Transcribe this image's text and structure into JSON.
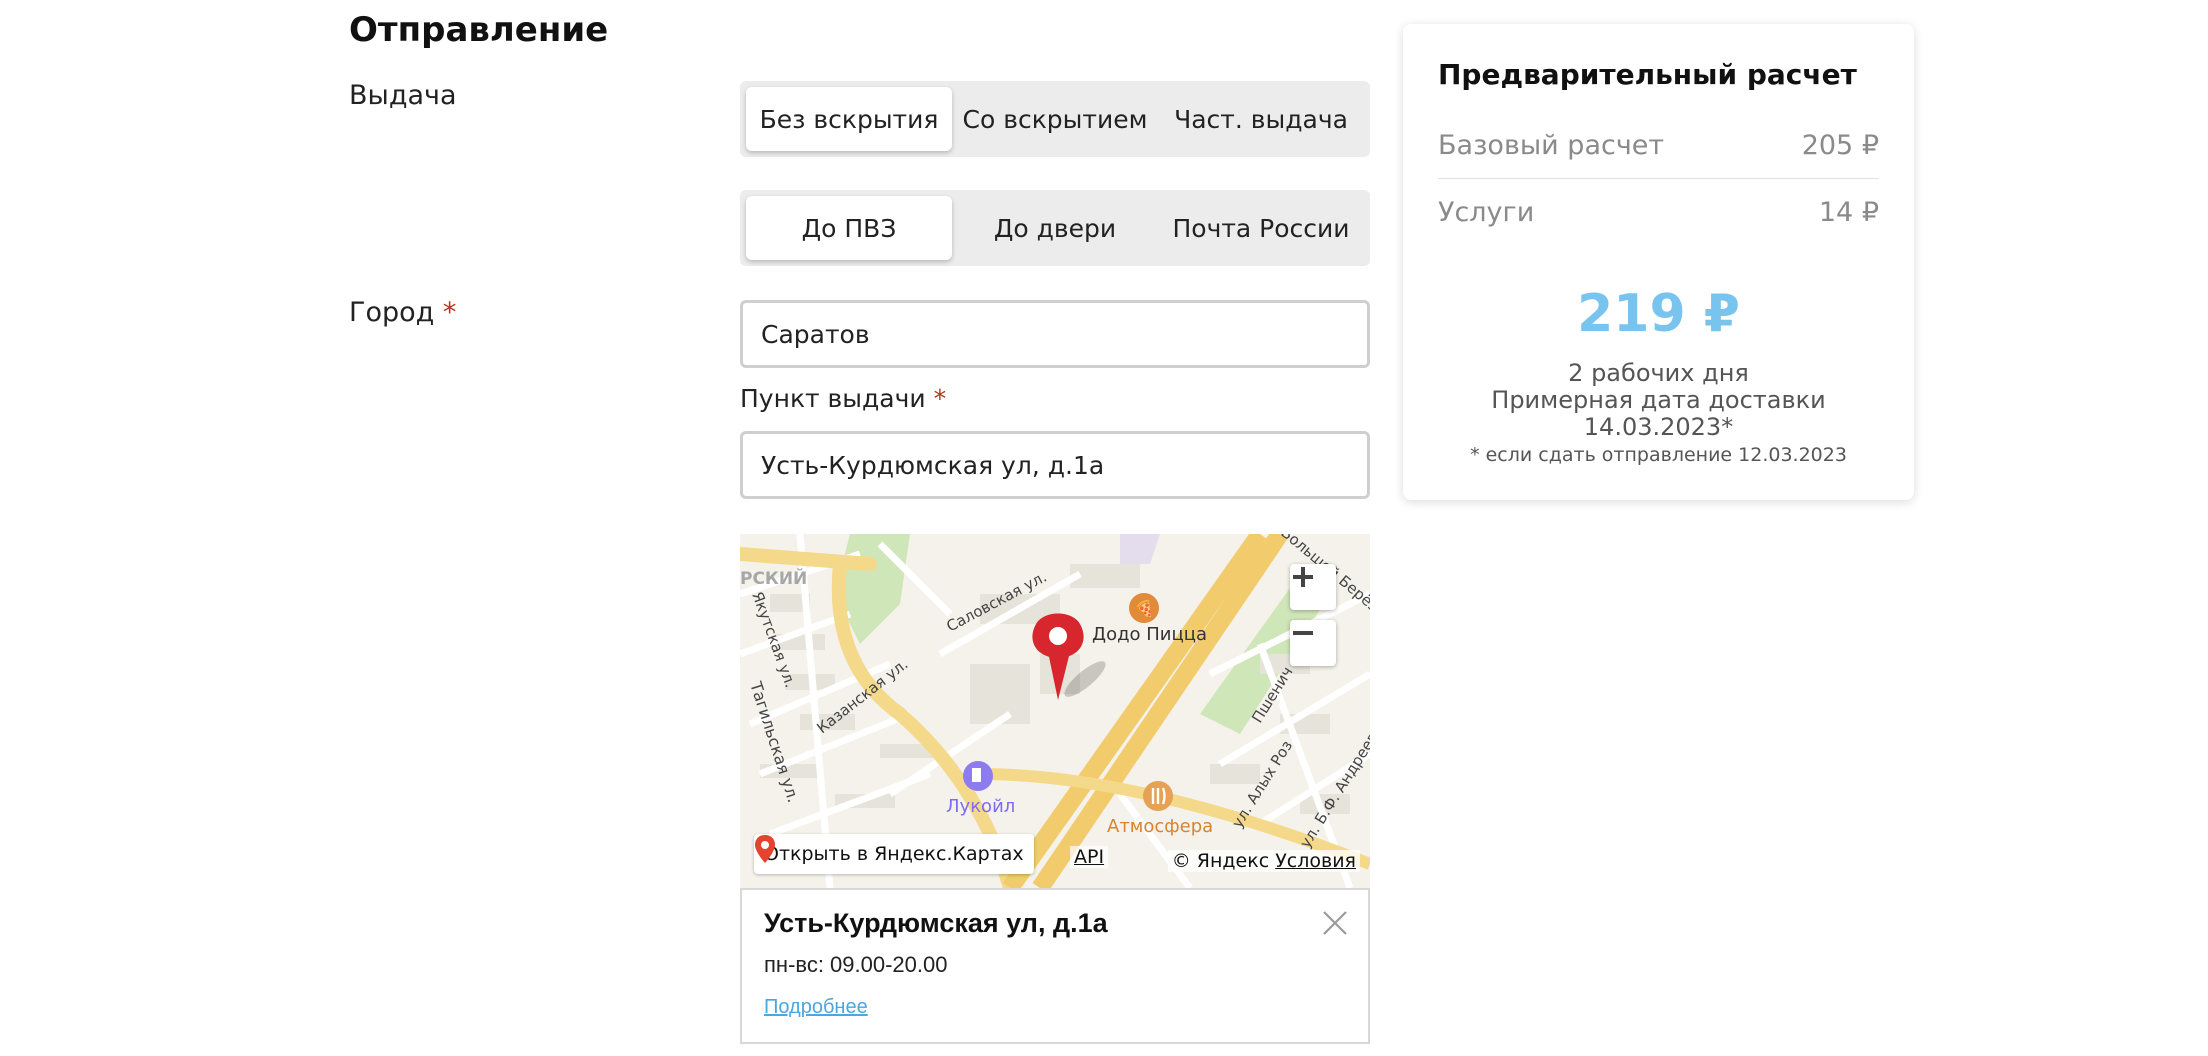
{
  "section": {
    "title": "Отправление"
  },
  "issue": {
    "label": "Выдача",
    "options": [
      "Без вскрытия",
      "Со вскрытием",
      "Част. выдача"
    ],
    "selected": "Без вскрытия"
  },
  "delivery": {
    "options": [
      "До ПВЗ",
      "До двери",
      "Почта России"
    ],
    "selected": "До ПВЗ"
  },
  "city": {
    "label": "Город",
    "required_mark": "*",
    "value": "Саратов"
  },
  "pickup_point": {
    "label": "Пункт выдачи",
    "required_mark": "*",
    "value": "Усть-Курдюмская ул, д.1а"
  },
  "map": {
    "labels": {
      "district": "РСКИЙ",
      "street_yakutskaya": "Якутская ул.",
      "street_salovskaya": "Саловская ул.",
      "street_kazanskaya": "Казанская ул.",
      "street_tagilskaya": "Тагильская ул.",
      "street_bolshoy": "Большой Берёзн",
      "street_pshenich": "Пшенич",
      "street_alykh_roz": "ул. Алых Роз",
      "street_andreeva": "ул. Б.Ф. Андреева"
    },
    "pois": {
      "dodo": "Додо Пицца",
      "lukoil": "Лукойл",
      "atmosfera": "Атмосфера"
    },
    "open_in_yandex": "Открыть в Яндекс.Картах",
    "api": "API",
    "copyright": "© Яндекс",
    "terms": "Условия"
  },
  "balloon": {
    "title": "Усть-Курдюмская ул, д.1а",
    "hours": "пн-вс: 09.00-20.00",
    "more": "Подробнее"
  },
  "summary": {
    "title": "Предварительный расчет",
    "base_label": "Базовый расчет",
    "base_value": "205 ₽",
    "services_label": "Услуги",
    "services_value": "14 ₽",
    "total": "219 ₽",
    "days": "2 рабочих дня",
    "date_label": "Примерная дата доставки",
    "date_value": "14.03.2023*",
    "footnote": "* если сдать отправление 12.03.2023"
  },
  "colors": {
    "accent_total": "#79c4ef",
    "required": "#b5331e",
    "marker": "#d7262e",
    "link": "#4aa7e0"
  }
}
